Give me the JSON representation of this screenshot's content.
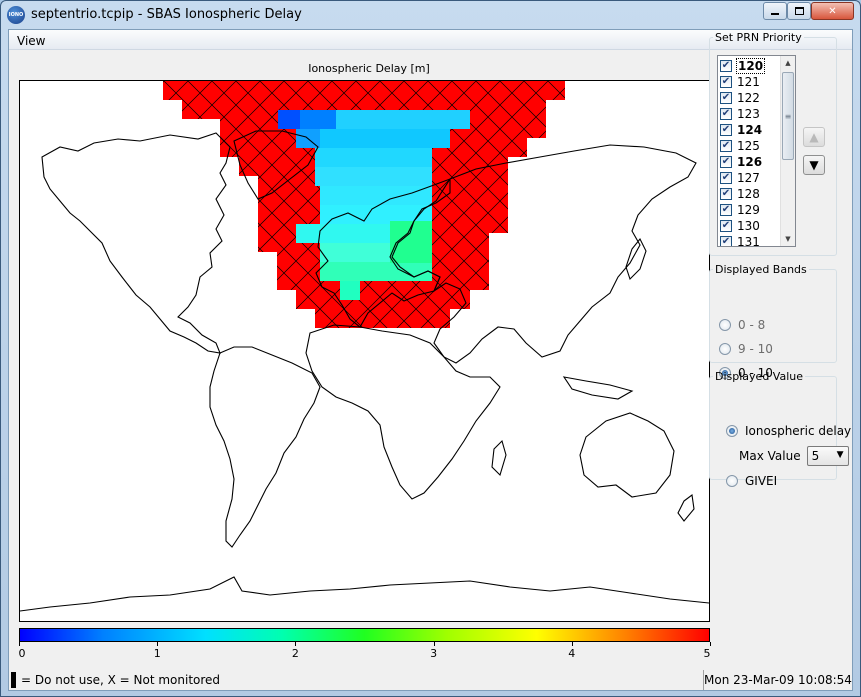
{
  "window": {
    "title": "septentrio.tcpip - SBAS Ionospheric Delay",
    "icon_text": "IONO",
    "icon": "iono-app-icon",
    "controls": [
      "minimize-icon",
      "maximize-icon",
      "close-icon"
    ]
  },
  "menu": {
    "items": [
      {
        "label": "View"
      }
    ]
  },
  "plot": {
    "title": "Ionospheric Delay [m]",
    "colorbar_ticks": [
      "0",
      "1",
      "2",
      "3",
      "4",
      "5"
    ],
    "colormap": "jet",
    "colors": {
      "not_monitored": "#ff0000",
      "low": "#0000ff",
      "high": "#ff0000"
    }
  },
  "prn_priority": {
    "title": "Set PRN Priority",
    "items": [
      {
        "label": "120",
        "checked": true,
        "bold": true
      },
      {
        "label": "121",
        "checked": true,
        "bold": false
      },
      {
        "label": "122",
        "checked": true,
        "bold": false
      },
      {
        "label": "123",
        "checked": true,
        "bold": false
      },
      {
        "label": "124",
        "checked": true,
        "bold": true
      },
      {
        "label": "125",
        "checked": true,
        "bold": false
      },
      {
        "label": "126",
        "checked": true,
        "bold": true
      },
      {
        "label": "127",
        "checked": true,
        "bold": false
      },
      {
        "label": "128",
        "checked": true,
        "bold": false
      },
      {
        "label": "129",
        "checked": true,
        "bold": false
      },
      {
        "label": "130",
        "checked": true,
        "bold": false
      },
      {
        "label": "131",
        "checked": true,
        "bold": false
      }
    ],
    "up_icon": "triangle-up-icon",
    "down_icon": "triangle-down-icon"
  },
  "bands": {
    "title": "Displayed Bands",
    "options": [
      {
        "label": "0 - 8",
        "selected": false
      },
      {
        "label": "9 - 10",
        "selected": false
      },
      {
        "label": "0 - 10",
        "selected": true
      }
    ]
  },
  "display_value": {
    "title": "Displayed Value",
    "iono_label": "Ionospheric delay",
    "iono_selected": true,
    "max_label": "Max Value",
    "max_value": "5",
    "givei_label": "GIVEI",
    "givei_selected": false
  },
  "status": {
    "legend_text": "= Do not use, X = Not monitored",
    "datetime": "Mon 23-Mar-09 10:08:54"
  }
}
